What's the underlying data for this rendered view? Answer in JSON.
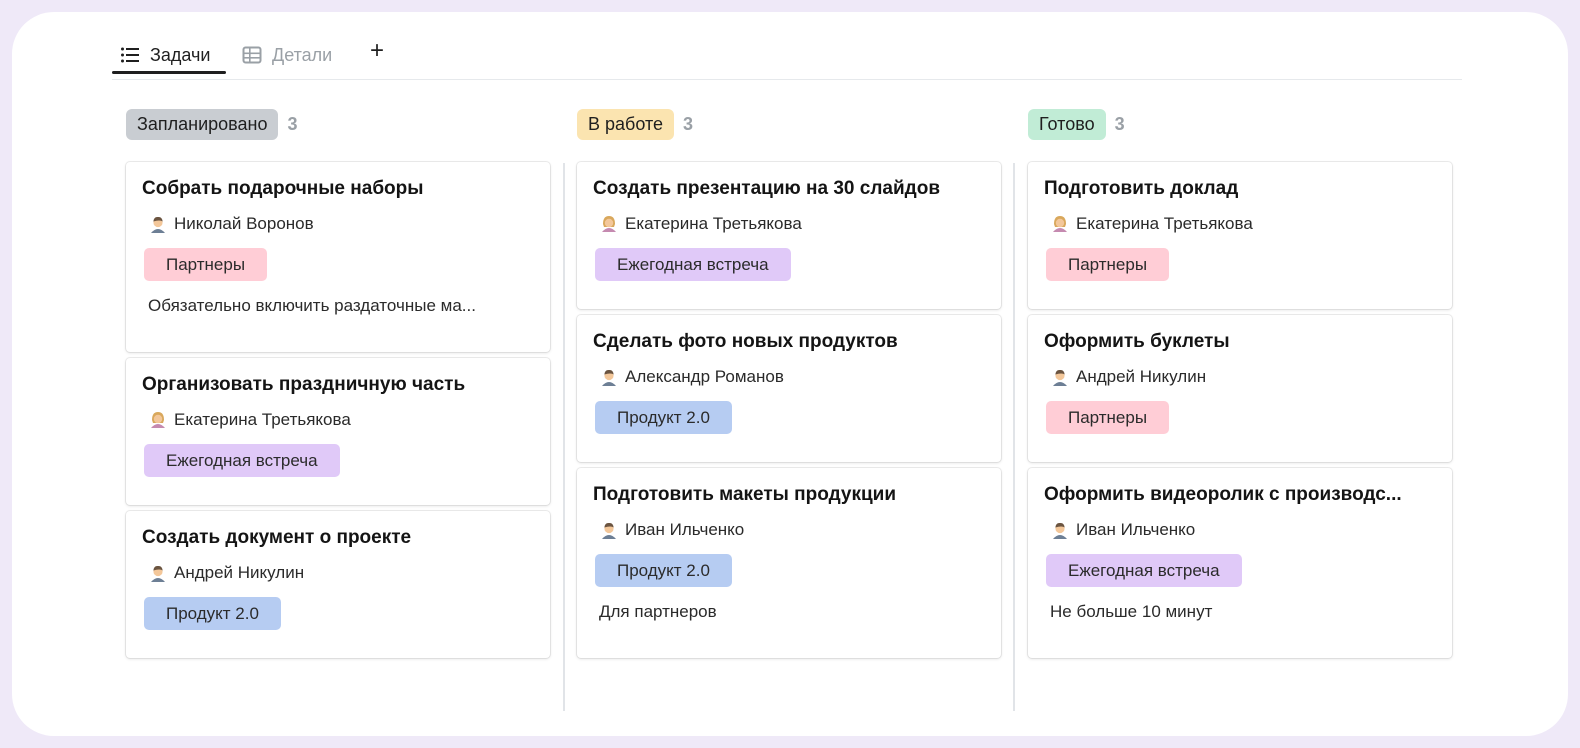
{
  "tabs": {
    "tasks_label": "Задачи",
    "details_label": "Детали",
    "add_label": "+"
  },
  "colors": {
    "status_planned": "#c9cdd2",
    "status_in_progress": "#fbe4b0",
    "status_done": "#c1ecd6",
    "tag_partners": "#ffcdd6",
    "tag_annual_meeting": "#e0c9f8",
    "tag_product": "#b6ccf2"
  },
  "columns": [
    {
      "status": "Запланировано",
      "count": "3",
      "cards": [
        {
          "title": "Собрать подарочные наборы",
          "assignee": "Николай Воронов",
          "avatar": "man-icon",
          "tag": "Партнеры",
          "note": "Обязательно включить раздаточные ма..."
        },
        {
          "title": "Организовать праздничную часть",
          "assignee": "Екатерина Третьякова",
          "avatar": "woman-icon",
          "tag": "Ежегодная встреча"
        },
        {
          "title": "Создать документ о проекте",
          "assignee": "Андрей Никулин",
          "avatar": "man-icon",
          "tag": "Продукт 2.0"
        }
      ]
    },
    {
      "status": "В работе",
      "count": "3",
      "cards": [
        {
          "title": "Создать презентацию на 30 слайдов",
          "assignee": "Екатерина Третьякова",
          "avatar": "woman-icon",
          "tag": "Ежегодная встреча"
        },
        {
          "title": "Сделать фото новых продуктов",
          "assignee": "Александр Романов",
          "avatar": "man-icon",
          "tag": "Продукт 2.0"
        },
        {
          "title": "Подготовить макеты продукции",
          "assignee": "Иван Ильченко",
          "avatar": "man-icon",
          "tag": "Продукт 2.0",
          "note": "Для партнеров"
        }
      ]
    },
    {
      "status": "Готово",
      "count": "3",
      "cards": [
        {
          "title": "Подготовить доклад",
          "assignee": "Екатерина Третьякова",
          "avatar": "woman-icon",
          "tag": "Партнеры"
        },
        {
          "title": "Оформить буклеты",
          "assignee": "Андрей Никулин",
          "avatar": "man-icon",
          "tag": "Партнеры"
        },
        {
          "title": "Оформить видеоролик с производс...",
          "assignee": "Иван Ильченко",
          "avatar": "man-icon",
          "tag": "Ежегодная встреча",
          "note": "Не больше 10 минут"
        }
      ]
    }
  ]
}
